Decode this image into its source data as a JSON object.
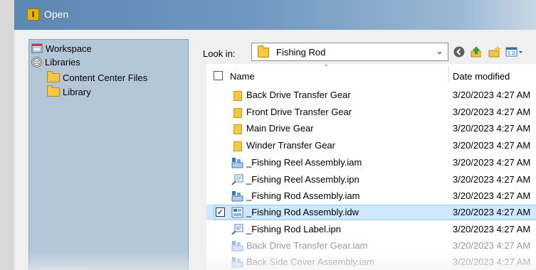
{
  "window": {
    "title": "Open",
    "icon": "inventor-app-icon"
  },
  "sidebar": {
    "items": [
      {
        "label": "Workspace",
        "icon": "workspace-icon"
      },
      {
        "label": "Libraries",
        "icon": "libraries-icon"
      },
      {
        "label": "Content Center Files",
        "icon": "folder-icon"
      },
      {
        "label": "Library",
        "icon": "folder-icon"
      }
    ]
  },
  "toolbar": {
    "look_in_label": "Look in:",
    "look_in_value": "Fishing Rod",
    "buttons": [
      "back-icon",
      "up-folder-icon",
      "new-folder-icon",
      "view-menu-icon"
    ]
  },
  "file_list": {
    "columns": {
      "name": "Name",
      "date": "Date modified"
    },
    "rows": [
      {
        "name": "Back Drive Transfer Gear",
        "date": "3/20/2023 4:27 AM",
        "type": "folder"
      },
      {
        "name": "Front Drive Transfer Gear",
        "date": "3/20/2023 4:27 AM",
        "type": "folder"
      },
      {
        "name": "Main Drive Gear",
        "date": "3/20/2023 4:27 AM",
        "type": "folder"
      },
      {
        "name": "Winder Transfer Gear",
        "date": "3/20/2023 4:27 AM",
        "type": "folder"
      },
      {
        "name": "_Fishing Reel Assembly.iam",
        "date": "3/20/2023 4:27 AM",
        "type": "iam"
      },
      {
        "name": "_Fishing Reel Assembly.ipn",
        "date": "3/20/2023 4:27 AM",
        "type": "ipn"
      },
      {
        "name": "_Fishing Rod Assembly.iam",
        "date": "3/20/2023 4:27 AM",
        "type": "iam"
      },
      {
        "name": "_Fishing Rod Assembly.idw",
        "date": "3/20/2023 4:27 AM",
        "type": "idw",
        "selected": true,
        "checked": true
      },
      {
        "name": "_Fishing Rod Label.ipn",
        "date": "3/20/2023 4:27 AM",
        "type": "ipn"
      },
      {
        "name": "Back Drive Transfer Gear.iam",
        "date": "3/20/2023 4:27 AM",
        "type": "iam"
      },
      {
        "name": "Back Side Cover Assembly.iam",
        "date": "3/20/2023 4:27 AM",
        "type": "iam"
      }
    ]
  },
  "colors": {
    "titlebar": "#5b87b3",
    "sidebar": "#b4c7d9",
    "selection": "#cde8ff"
  }
}
